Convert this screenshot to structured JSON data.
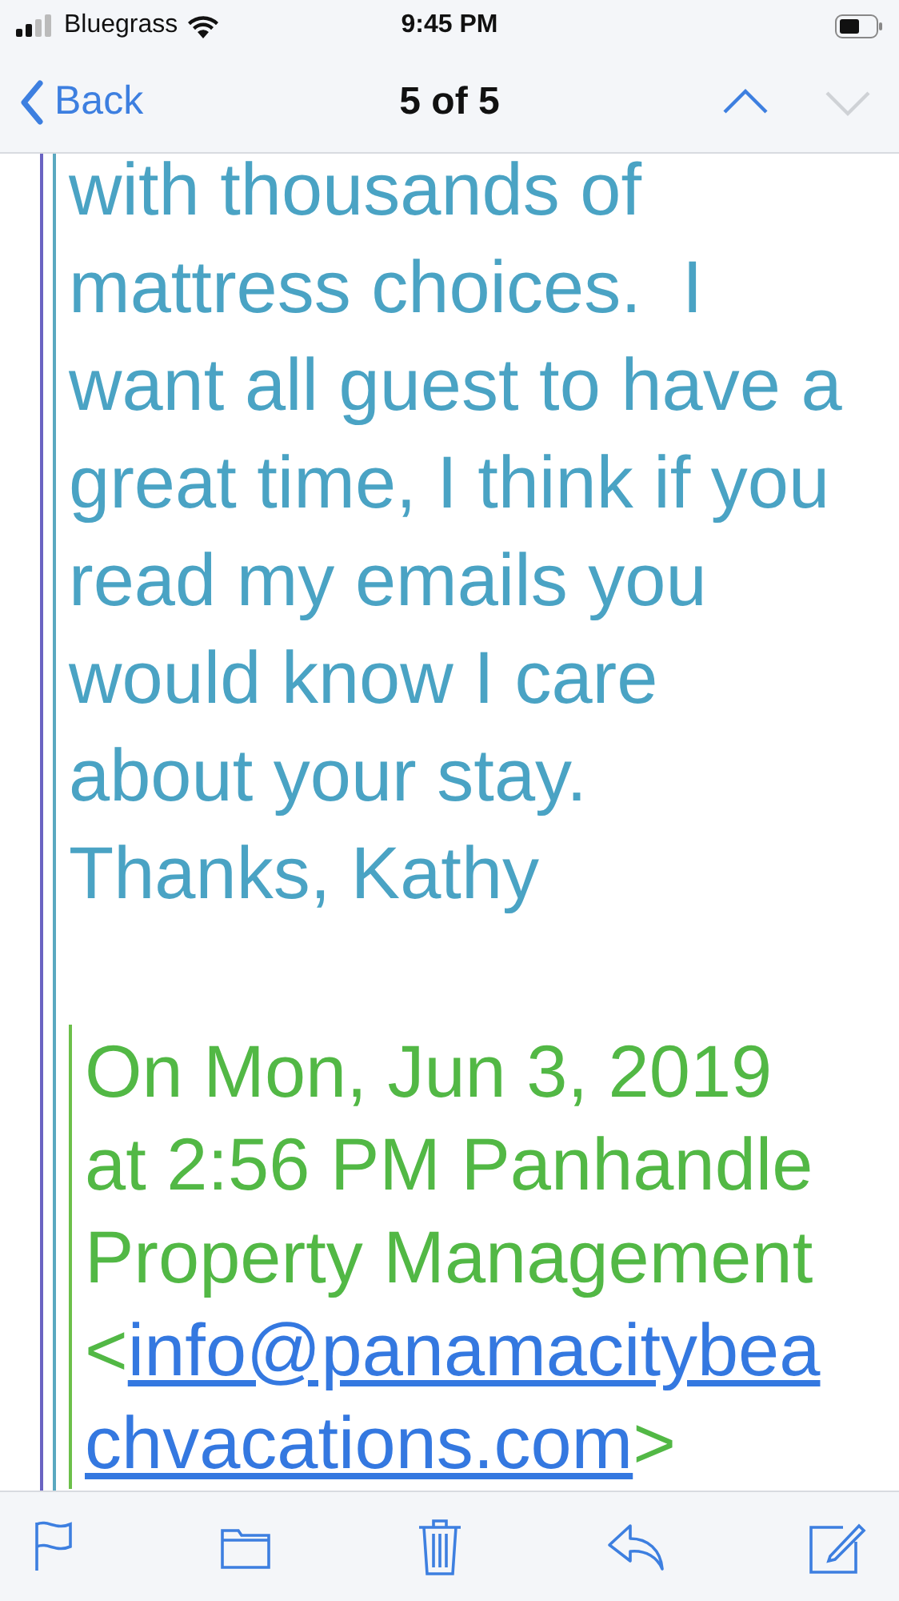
{
  "status_bar": {
    "carrier": "Bluegrass",
    "time": "9:45 PM"
  },
  "nav_bar": {
    "back": "Back",
    "title": "5 of 5",
    "previous": {
      "disabled": false
    },
    "next": {
      "disabled": true
    }
  },
  "message": {
    "quoted_body": "with thousands of\nmattress choices.  I\nwant all guest to have a\ngreat time, I think if you\nread my emails you\nwould know I care\nabout your stay.\nThanks, Kathy",
    "attribution": "On Mon, Jun 3, 2019\nat 2:56 PM Panhandle\nProperty Management\n<",
    "email_link": "info@panamacitybeachvacations.com",
    "attribution_end": ">"
  },
  "toolbar": [
    {
      "kind": "flag"
    },
    {
      "kind": "folder"
    },
    {
      "kind": "trash"
    },
    {
      "kind": "reply"
    },
    {
      "kind": "compose"
    }
  ]
}
